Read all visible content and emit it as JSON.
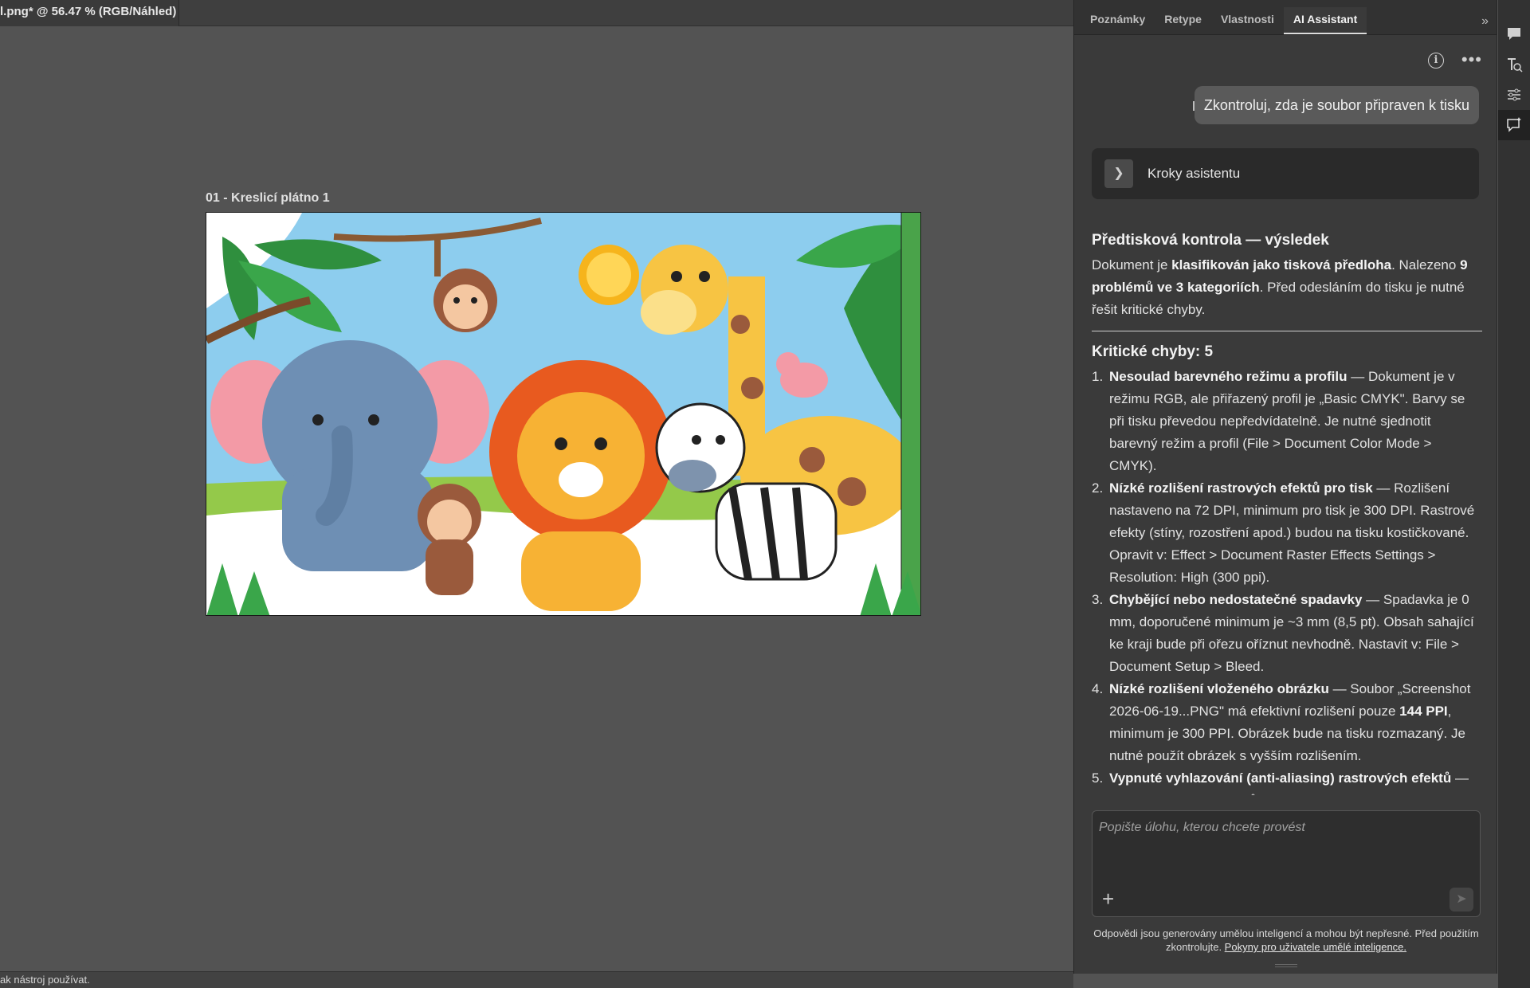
{
  "document": {
    "tab_title": "l.png* @ 56.47 % (RGB/Náhled)",
    "artboard_label": "01 - Kreslicí plátno 1"
  },
  "statusbar": {
    "text": "ak nástroj používat."
  },
  "panel": {
    "tabs": [
      {
        "label": "Poznámky"
      },
      {
        "label": "Retype"
      },
      {
        "label": "Vlastnosti"
      },
      {
        "label": "AI Assistant",
        "active": true
      }
    ],
    "collapse_glyph": "»",
    "user_message": "Zkontroluj, zda je soubor připraven k tisku",
    "steps_label": "Kroky asistentu",
    "result": {
      "title": "Předtisková kontrola — výsledek",
      "summary_pre": "Dokument je ",
      "summary_b1": "klasifikován jako tisková předloha",
      "summary_mid": ". Nalezeno ",
      "summary_b2": "9 problémů ve 3 kategoriích",
      "summary_post": ". Před odesláním do tisku je nutné řešit kritické chyby.",
      "critical_title": "Kritické chyby: 5",
      "items": [
        {
          "num": "1.",
          "bold": "Nesoulad barevného režimu a profilu",
          "text": " — Dokument je v režimu RGB, ale přiřazený profil je „Basic CMYK\". Barvy se při tisku převedou nepředvídatelně. Je nutné sjednotit barevný režim a profil (File > Document Color Mode > CMYK)."
        },
        {
          "num": "2.",
          "bold": "Nízké rozlišení rastrových efektů pro tisk",
          "text": " — Rozlišení nastaveno na 72 DPI, minimum pro tisk je 300 DPI. Rastrové efekty (stíny, rozostření apod.) budou na tisku kostičkované. Opravit v: Effect > Document Raster Effects Settings > Resolution: High (300 ppi)."
        },
        {
          "num": "3.",
          "bold": "Chybějící nebo nedostatečné spadavky",
          "text": " — Spadavka je 0 mm, doporučené minimum je ~3 mm (8,5 pt). Obsah sahající ke kraji bude při ořezu oříznut nevhodně. Nastavit v: File > Document Setup > Bleed."
        },
        {
          "num": "4.",
          "bold": "Nízké rozlišení vloženého obrázku",
          "text_pre": " — Soubor „Screenshot 2026-06-19...PNG\" má efektivní rozlišení pouze ",
          "text_b": "144 PPI",
          "text": ", minimum je 300 PPI. Obrázek bude na tisku rozmazaný. Je nutné použít obrázek s vyšším rozlišením."
        },
        {
          "num": "5.",
          "bold": "Vypnuté vyhlazování (anti-aliasing) rastrových efektů",
          "text": " — Kvalita rastrových efektů bude nižší. Zapnout v: Effect >"
        }
      ]
    },
    "input_placeholder": "Popište úlohu, kterou chcete provést",
    "disclaimer_text": "Odpovědi jsou generovány umělou inteligencí a mohou být nepřesné. Před použitím zkontrolujte. ",
    "disclaimer_link": "Pokyny pro uživatele umělé inteligence."
  },
  "colors": {
    "workspace": "#535353",
    "panel": "#3a3a3a",
    "bubble": "#5a5a5a"
  }
}
